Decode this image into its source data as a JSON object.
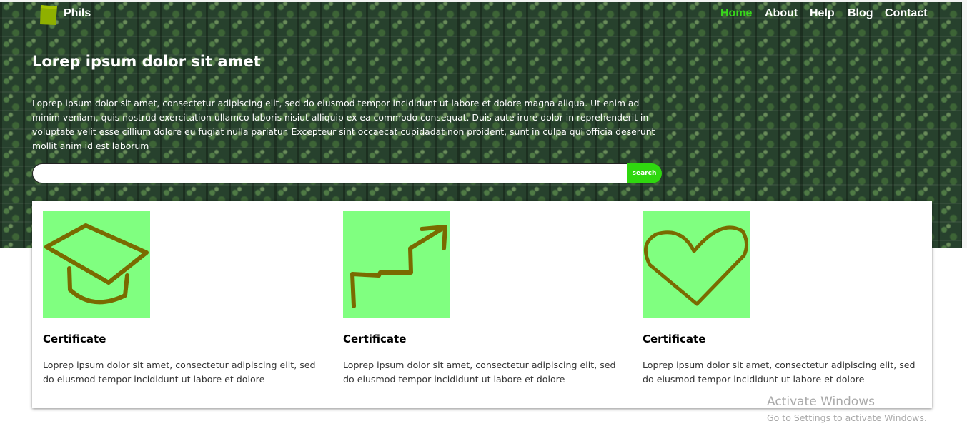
{
  "header": {
    "brand": "Phils",
    "nav": [
      {
        "label": "Home",
        "active": true
      },
      {
        "label": "About"
      },
      {
        "label": "Help"
      },
      {
        "label": "Blog"
      },
      {
        "label": "Contact"
      }
    ]
  },
  "hero": {
    "title": "Lorep ipsum dolor sit amet",
    "text": "Loprep ipsum dolor sit amet, consectetur adipiscing elit, sed do eiusmod tempor incididunt ut labore et dolore magna aliqua. Ut enim ad minim veniam, quis nostrud exercitation ullamco laboris nisiut alliquip ex ea commodo consequat. Duis aute irure dolor in reprehenderit in voluptate velit esse cillium dolore eu fugiat nulla pariatur. Excepteur sint occaecat cupidadat non proident, sunt in culpa qui officia deserunt mollit anim id est laborum"
  },
  "search": {
    "value": "",
    "placeholder": "",
    "button_label": "search"
  },
  "cards": [
    {
      "icon": "graduation-cap-icon",
      "title": "Certificate",
      "text": "Loprep ipsum dolor sit amet, consectetur adipiscing elit, sed do eiusmod tempor incididunt ut labore et dolore"
    },
    {
      "icon": "growth-arrow-icon",
      "title": "Certificate",
      "text": "Loprep ipsum dolor sit amet, consectetur adipiscing elit, sed do eiusmod tempor incididunt ut labore et dolore"
    },
    {
      "icon": "heart-icon",
      "title": "Certificate",
      "text": "Loprep ipsum dolor sit amet, consectetur adipiscing elit, sed do eiusmod tempor incididunt ut labore et dolore"
    }
  ],
  "watermark": {
    "title": "Activate Windows",
    "subtitle": "Go to Settings to activate Windows."
  },
  "colors": {
    "accent": "#38d81b",
    "search_button": "#2fd80f",
    "card_icon_bg": "#80ff80",
    "icon_stroke": "#7a6a00",
    "logo": "#8fb000"
  }
}
